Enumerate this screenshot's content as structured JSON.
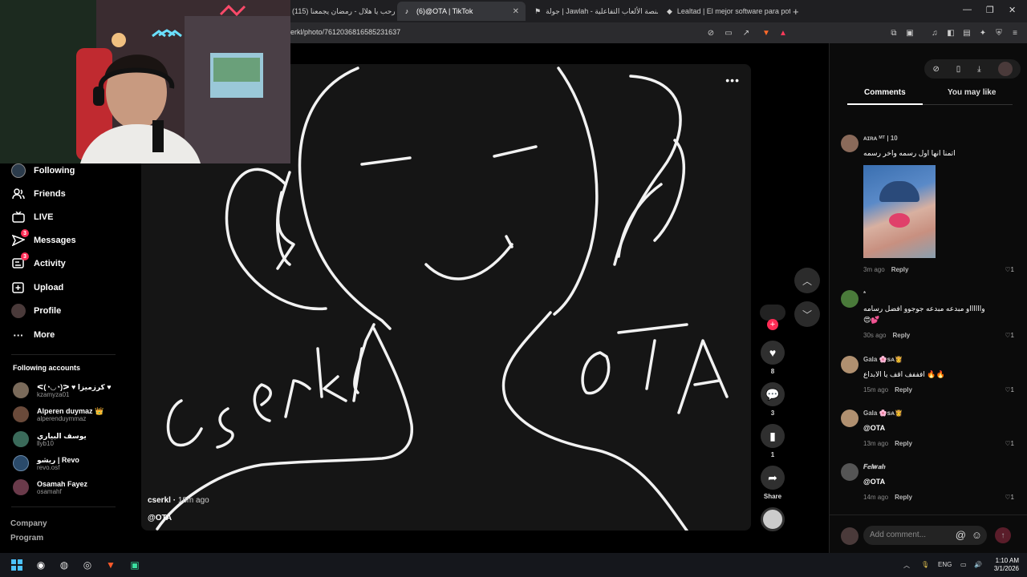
{
  "browser": {
    "tabs": [
      {
        "label": "(115) مرحب يا هلال - رمضان يجمعنا",
        "active": false
      },
      {
        "label": "(6)@OTA | TikTok",
        "active": true
      },
      {
        "label": "جولة | Jawlah - منصة الألعاب التفاعلية",
        "active": false
      },
      {
        "label": "Lealtad | El mejor software para pote",
        "active": false
      }
    ],
    "new_tab": "+",
    "url": "erkl/photo/7612036816585231637"
  },
  "sidebar": {
    "items": [
      {
        "label": "Following",
        "icon": "following-avatar"
      },
      {
        "label": "Friends",
        "icon": "friends-icon"
      },
      {
        "label": "LIVE",
        "icon": "live-icon"
      },
      {
        "label": "Messages",
        "icon": "messages-icon",
        "badge": "3"
      },
      {
        "label": "Activity",
        "icon": "activity-icon",
        "badge": "3"
      },
      {
        "label": "Upload",
        "icon": "upload-icon"
      },
      {
        "label": "Profile",
        "icon": "profile-avatar"
      },
      {
        "label": "More",
        "icon": "more-icon"
      }
    ],
    "following_header": "Following accounts",
    "accounts": [
      {
        "name": "ᕙ(◔◡◔)ᕗ ♥ كرزميزا ♥",
        "handle": "kzamyza01",
        "color": "#7a6a5a"
      },
      {
        "name": "Alperen duymaz 👑",
        "handle": "alperenduymmaz",
        "color": "#6a4a3a"
      },
      {
        "name": "يوسف البياري",
        "handle": "llyb10",
        "color": "#3a6a5a"
      },
      {
        "name": "ريشو | Revo",
        "handle": "revo.osf",
        "color": "#2a4a6a"
      },
      {
        "name": "Osamah Fayez",
        "handle": "osamahf",
        "color": "#6a3a4a"
      }
    ],
    "footer": [
      "Company",
      "Program"
    ]
  },
  "video": {
    "author": "cserkl",
    "time": "18m ago",
    "caption": "@OTA"
  },
  "actions": {
    "likes": "8",
    "comments": "3",
    "saves": "1",
    "share_label": "Share"
  },
  "comments_panel": {
    "tabs": [
      "Comments",
      "You may like"
    ],
    "comments": [
      {
        "name": "ᴀɪʀᴀ ᴹᵀ | 10",
        "text": "اتمنا انها اول رسمه واخر رسمه",
        "time": "3m ago",
        "reply": "Reply",
        "likes": "1",
        "color": "#8a6a5a"
      },
      {
        "name": "*",
        "text": "وااااااو مبدعه مبدعه جوجوو افضل رسامه",
        "text2": "😍💕",
        "time": "30s ago",
        "reply": "Reply",
        "likes": "1",
        "color": "#4a7a3a"
      },
      {
        "name": "Gala 🌸ꜱᴀ👸",
        "text": "افففف اقف يا الابداع 🔥🔥",
        "time": "15m ago",
        "reply": "Reply",
        "likes": "1",
        "color": "#b09070"
      },
      {
        "name": "Gala 🌸ꜱᴀ👸",
        "text": "@OTA",
        "time": "13m ago",
        "reply": "Reply",
        "likes": "1",
        "color": "#b09070"
      },
      {
        "name": "𝑭𝒆𝒍𝒘𝒂𝒉",
        "text": "@OTA",
        "time": "14m ago",
        "reply": "Reply",
        "likes": "1",
        "color": "#555"
      }
    ],
    "add_placeholder": "Add comment..."
  },
  "taskbar": {
    "lang": "ENG",
    "time": "1:10 AM",
    "date": "3/1/2026"
  }
}
